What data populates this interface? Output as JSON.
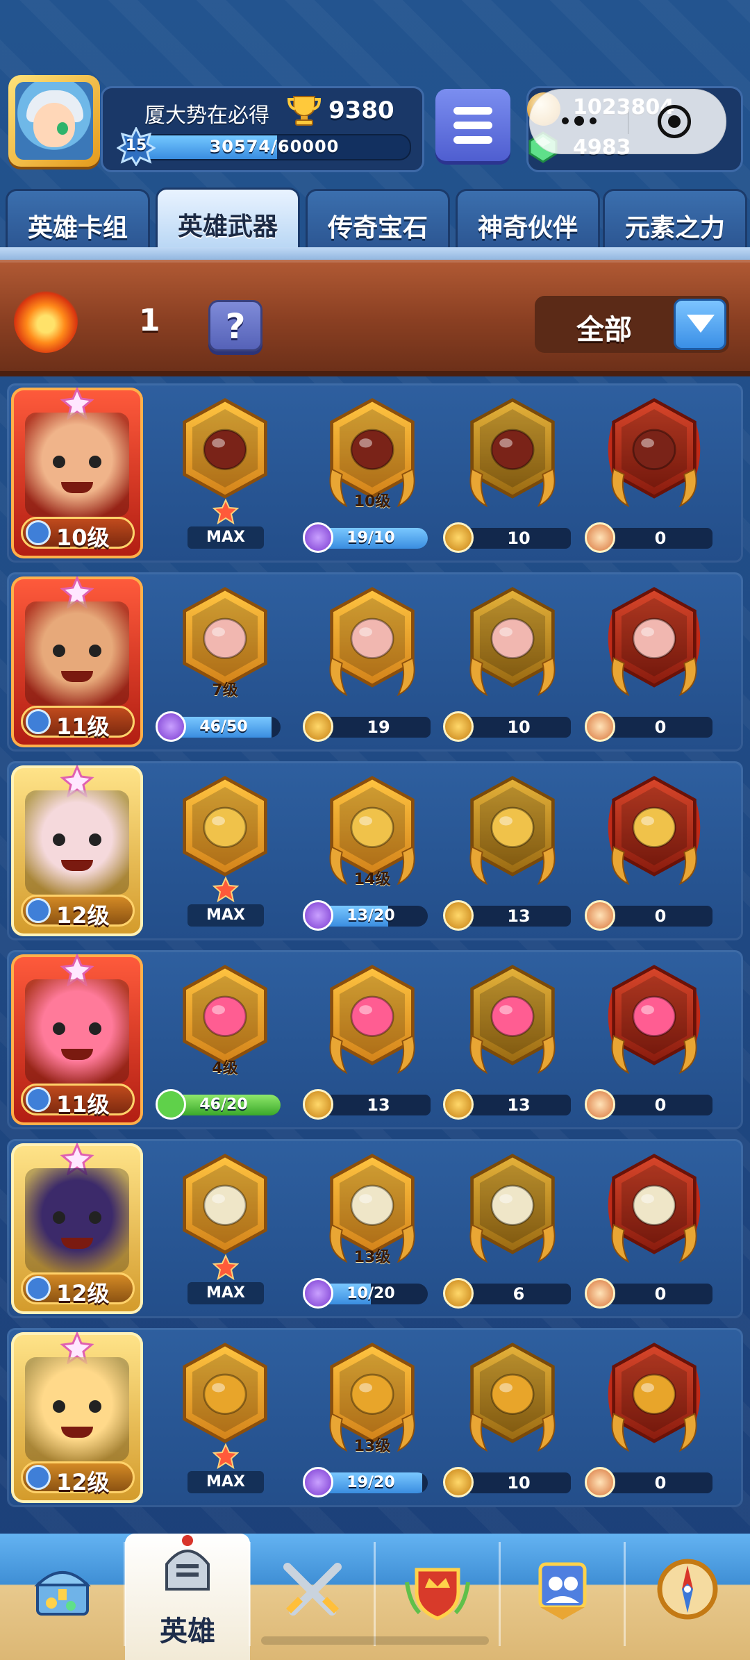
{
  "header": {
    "player_name": "厦大势在必得",
    "trophies": "9380",
    "player_level": "15",
    "xp_text": "30574/60000",
    "xp_fraction": 0.51,
    "coins": "1023804",
    "gems": "4983",
    "icons": {
      "avatar": "player-avatar",
      "trophy": "trophy-icon",
      "menu": "menu-icon",
      "coin": "coin-icon",
      "gem": "gem-icon",
      "more": "more-icon",
      "close": "close-icon"
    }
  },
  "tabs": [
    {
      "label": "英雄卡组",
      "active": false
    },
    {
      "label": "英雄武器",
      "active": true
    },
    {
      "label": "传奇宝石",
      "active": false
    },
    {
      "label": "神奇伙伴",
      "active": false
    },
    {
      "label": "元素之力",
      "active": false
    }
  ],
  "filter": {
    "fire_count": "1",
    "help_label": "?",
    "dropdown_label": "全部"
  },
  "heroes": [
    {
      "level_label": "10级",
      "card_style": "red",
      "portrait_color": "#f0b48a",
      "weapon_color": "#7a2318",
      "weapon_name": "fist-icon",
      "slots": [
        {
          "type": "max",
          "level": "",
          "label": "MAX"
        },
        {
          "type": "bar",
          "level": "10级",
          "label": "19/10",
          "fraction": 1.0
        },
        {
          "type": "plain",
          "level": "",
          "label": "10"
        },
        {
          "type": "plain",
          "level": "",
          "label": "0"
        }
      ]
    },
    {
      "level_label": "11级",
      "card_style": "red",
      "portrait_color": "#e7a97a",
      "weapon_color": "#f1b7b0",
      "weapon_name": "feather-duster-icon",
      "slots": [
        {
          "type": "bar",
          "level": "7级",
          "label": "46/50",
          "fraction": 0.92
        },
        {
          "type": "plain",
          "level": "",
          "label": "19"
        },
        {
          "type": "plain",
          "level": "",
          "label": "10"
        },
        {
          "type": "plain",
          "level": "",
          "label": "0"
        }
      ]
    },
    {
      "level_label": "12级",
      "card_style": "gold",
      "portrait_color": "#f5d9dc",
      "weapon_color": "#f0c24a",
      "weapon_name": "lyre-icon",
      "slots": [
        {
          "type": "max",
          "level": "",
          "label": "MAX"
        },
        {
          "type": "bar",
          "level": "14级",
          "label": "13/20",
          "fraction": 0.65
        },
        {
          "type": "plain",
          "level": "",
          "label": "13"
        },
        {
          "type": "plain",
          "level": "",
          "label": "0"
        }
      ]
    },
    {
      "level_label": "11级",
      "card_style": "red",
      "portrait_color": "#ff7a9a",
      "weapon_color": "#ff5d92",
      "weapon_name": "slime-icon",
      "slots": [
        {
          "type": "upgrade",
          "level": "4级",
          "label": "46/20",
          "fraction": 1.0
        },
        {
          "type": "plain",
          "level": "",
          "label": "13"
        },
        {
          "type": "plain",
          "level": "",
          "label": "13"
        },
        {
          "type": "plain",
          "level": "",
          "label": "0"
        }
      ]
    },
    {
      "level_label": "12级",
      "card_style": "gold",
      "portrait_color": "#3c2a6a",
      "weapon_color": "#efe6c8",
      "weapon_name": "scroll-icon",
      "slots": [
        {
          "type": "max",
          "level": "",
          "label": "MAX"
        },
        {
          "type": "bar",
          "level": "13级",
          "label": "10/20",
          "fraction": 0.5
        },
        {
          "type": "plain",
          "level": "",
          "label": "6"
        },
        {
          "type": "plain",
          "level": "",
          "label": "0"
        }
      ]
    },
    {
      "level_label": "12级",
      "card_style": "gold",
      "portrait_color": "#ffd98a",
      "weapon_color": "#e8a52a",
      "weapon_name": "scepter-icon",
      "slots": [
        {
          "type": "max",
          "level": "",
          "label": "MAX"
        },
        {
          "type": "bar",
          "level": "13级",
          "label": "19/20",
          "fraction": 0.95
        },
        {
          "type": "plain",
          "level": "",
          "label": "10"
        },
        {
          "type": "plain",
          "level": "",
          "label": "0"
        }
      ]
    }
  ],
  "bottom_nav": [
    {
      "icon": "treasure-chest-icon",
      "label": "",
      "active": false
    },
    {
      "icon": "knight-helmet-icon",
      "label": "英雄",
      "active": true
    },
    {
      "icon": "crossed-swords-icon",
      "label": "",
      "active": false
    },
    {
      "icon": "crown-shield-icon",
      "label": "",
      "active": false
    },
    {
      "icon": "guild-banner-icon",
      "label": "",
      "active": false
    },
    {
      "icon": "compass-icon",
      "label": "",
      "active": false
    }
  ]
}
